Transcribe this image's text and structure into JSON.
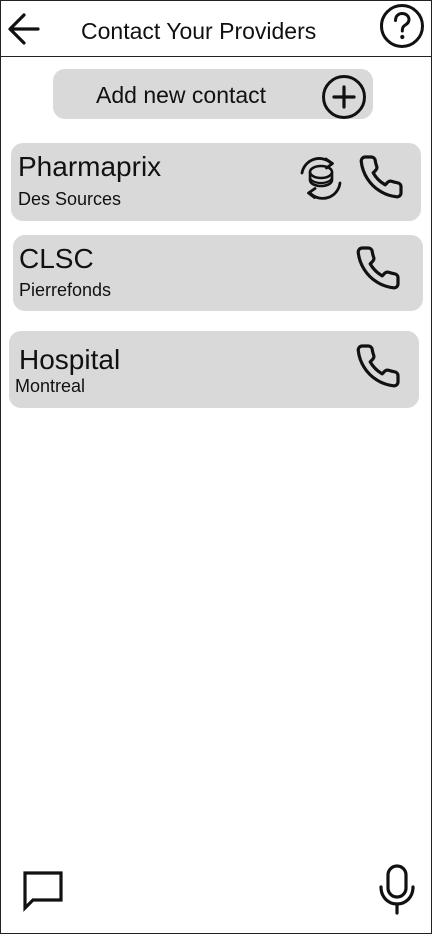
{
  "header": {
    "title": "Contact Your Providers"
  },
  "actions": {
    "add_contact_label": "Add new contact"
  },
  "contacts": [
    {
      "name": "Pharmaprix",
      "location": "Des Sources"
    },
    {
      "name": "CLSC",
      "location": "Pierrefonds"
    },
    {
      "name": "Hospital",
      "location": "Montreal"
    }
  ],
  "icons": {
    "back": "arrow-left-icon",
    "help": "question-circle-icon",
    "add": "plus-circle-icon",
    "refill": "refill-medication-icon",
    "call": "phone-icon",
    "chat": "chat-bubble-icon",
    "mic": "microphone-icon"
  },
  "colors": {
    "card_background": "#d9d9d9",
    "icon_stroke": "#111111"
  }
}
